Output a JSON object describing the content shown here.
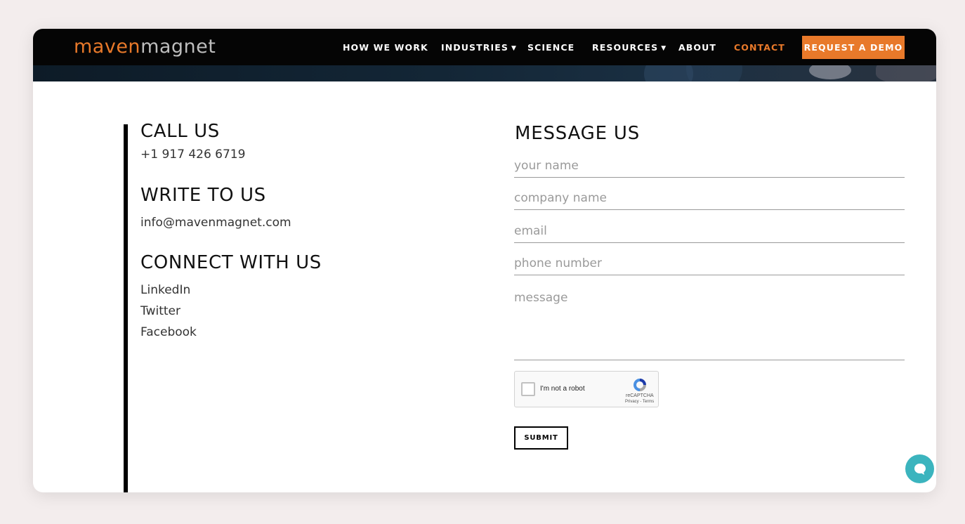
{
  "header": {
    "logo_part1": "maven",
    "logo_part2": "magnet",
    "nav": [
      {
        "label": "HOW WE WORK"
      },
      {
        "label": "INDUSTRIES"
      },
      {
        "label": "SCIENCE"
      },
      {
        "label": "RESOURCES"
      },
      {
        "label": "ABOUT"
      },
      {
        "label": "CONTACT"
      }
    ],
    "cta_label": "REQUEST A DEMO"
  },
  "contact": {
    "call_heading": "CALL US",
    "phone": "+1 917 426 6719",
    "write_heading": "WRITE TO US",
    "email": "info@mavenmagnet.com",
    "connect_heading": "CONNECT WITH US",
    "social": [
      "LinkedIn",
      "Twitter",
      "Facebook"
    ]
  },
  "form": {
    "heading": "MESSAGE US",
    "name_placeholder": "your name",
    "company_placeholder": "company name",
    "email_placeholder": "email",
    "phone_placeholder": "phone number",
    "message_placeholder": "message",
    "captcha_label": "I'm not a robot",
    "captcha_brand": "reCAPTCHA",
    "captcha_terms": "Privacy - Terms",
    "submit_label": "SUBMIT"
  },
  "colors": {
    "accent": "#e8792a",
    "chat": "#3bb4be",
    "header_bg": "#050505"
  },
  "icons": {
    "chat": "chat-bubble-icon",
    "caret": "caret-down-icon",
    "recaptcha": "recaptcha-icon"
  }
}
